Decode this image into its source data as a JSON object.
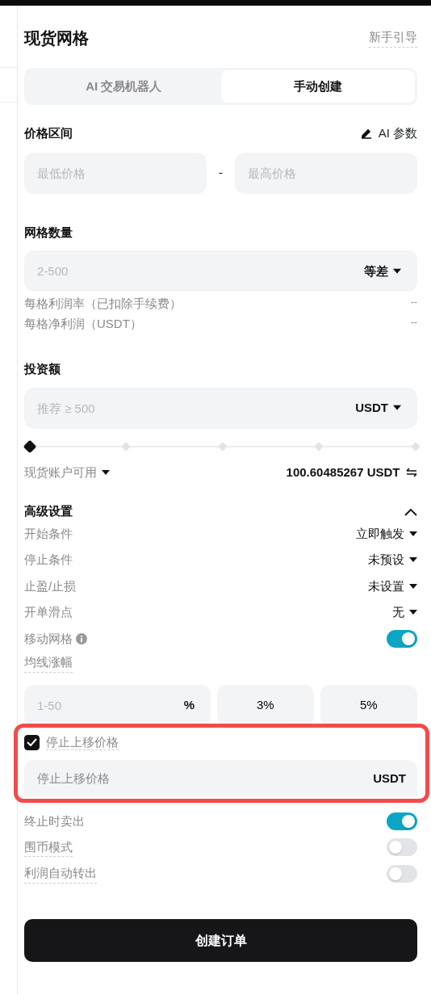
{
  "header": {
    "title": "现货网格",
    "guide_link": "新手引导"
  },
  "tabs": [
    {
      "label": "AI 交易机器人",
      "selected": false
    },
    {
      "label": "手动创建",
      "selected": true
    }
  ],
  "price_range": {
    "label": "价格区间",
    "ai_params": "AI 参数",
    "min_placeholder": "最低价格",
    "separator": "-",
    "max_placeholder": "最高价格"
  },
  "grid_count": {
    "label": "网格数量",
    "placeholder": "2-500",
    "mode": "等差",
    "stats": [
      {
        "label": "每格利润率（已扣除手续费）",
        "value": "--"
      },
      {
        "label": "每格净利润（USDT）",
        "value": "--"
      }
    ]
  },
  "investment": {
    "label": "投资额",
    "placeholder": "推荐 ≥ 500",
    "currency": "USDT",
    "slider": {
      "level": 0
    },
    "account_label": "现货账户可用",
    "balance": "100.60485267 USDT"
  },
  "advanced": {
    "title": "高级设置",
    "expanded": true,
    "rows": [
      {
        "kind": "select",
        "label": "开始条件",
        "value": "立即触发"
      },
      {
        "kind": "select",
        "label": "停止条件",
        "value": "未预设"
      },
      {
        "kind": "select",
        "label": "止盈/止损",
        "value": "未设置"
      },
      {
        "kind": "select",
        "label": "开单滑点",
        "value": "无"
      },
      {
        "kind": "toggle",
        "label": "移动网格",
        "info": true,
        "on": true
      }
    ]
  },
  "ma_rise": {
    "label": "均线涨幅",
    "placeholder": "1-50",
    "unit": "%",
    "presets": [
      "3%",
      "5%"
    ]
  },
  "stop_price": {
    "checked": true,
    "label": "停止上移价格",
    "placeholder": "停止上移价格",
    "unit": "USDT",
    "highlighted": true
  },
  "toggles": [
    {
      "label": "终止时卖出",
      "on": true,
      "has_tip": false
    },
    {
      "label": "围币模式",
      "on": false,
      "has_tip": true
    },
    {
      "label": "利润自动转出",
      "on": false,
      "has_tip": true
    }
  ],
  "submit": "创建订单"
}
